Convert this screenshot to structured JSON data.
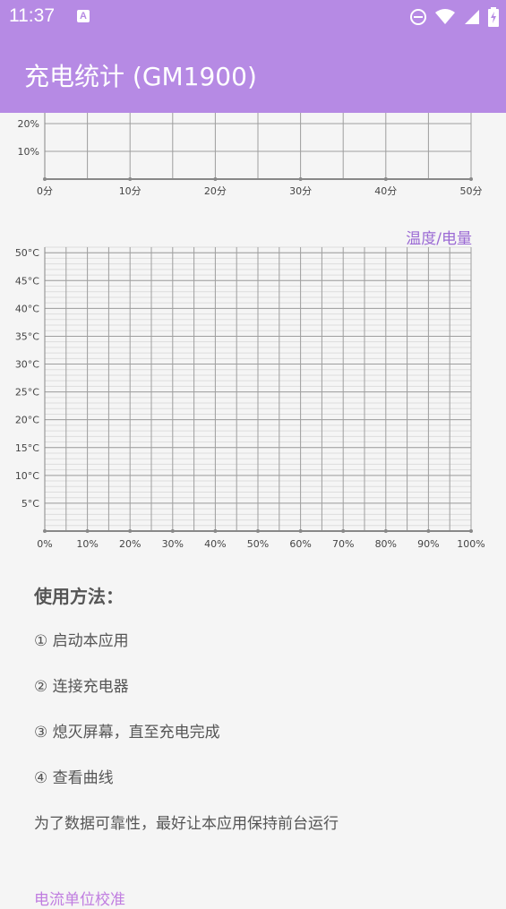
{
  "status_bar": {
    "time": "11:37",
    "badge": "A",
    "icons": [
      "do-not-disturb-icon",
      "wifi-icon",
      "cell-signal-icon",
      "battery-icon"
    ]
  },
  "app_bar": {
    "title": "充电统计 (GM1900)"
  },
  "top_chart": {
    "y_ticks": [
      "20%",
      "10%"
    ],
    "x_ticks": [
      "0分",
      "10分",
      "20分",
      "30分",
      "40分",
      "50分"
    ]
  },
  "bottom_chart": {
    "legend": "温度/电量",
    "y_ticks": [
      "50°C",
      "45°C",
      "40°C",
      "35°C",
      "30°C",
      "25°C",
      "20°C",
      "15°C",
      "10°C",
      "5°C"
    ],
    "x_ticks": [
      "0%",
      "10%",
      "20%",
      "30%",
      "40%",
      "50%",
      "60%",
      "70%",
      "80%",
      "90%",
      "100%"
    ]
  },
  "usage": {
    "heading": "使用方法：",
    "steps": [
      "① 启动本应用",
      "② 连接充电器",
      "③ 熄灭屏幕，直至充电完成",
      "④ 查看曲线"
    ],
    "note": "为了数据可靠性，最好让本应用保持前台运行"
  },
  "footer": {
    "link": "电流单位校准"
  },
  "colors": {
    "accent": "#b68ae4",
    "legend": "#9b6ad4",
    "grid_major": "#9e9e9e",
    "grid_minor": "#dddddd"
  }
}
